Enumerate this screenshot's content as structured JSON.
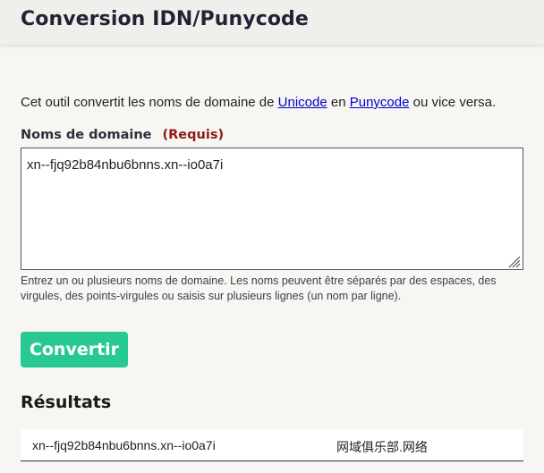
{
  "header": {
    "title": "Conversion IDN/Punycode"
  },
  "intro": {
    "prefix": "Cet outil convertit les noms de domaine de ",
    "link_unicode": "Unicode",
    "middle": " en ",
    "link_punycode": "Punycode",
    "suffix": " ou vice versa."
  },
  "form": {
    "label": "Noms de domaine",
    "required": "(Requis)",
    "value": "xn--fjq92b84nbu6bnns.xn--io0a7i",
    "help": "Entrez un ou plusieurs noms de domaine. Les noms peuvent être séparés par des espaces, des virgules, des points-virgules ou saisis sur plusieurs lignes (un nom par ligne).",
    "button_label": "Convertir"
  },
  "results": {
    "title": "Résultats",
    "rows": [
      {
        "punycode": "xn--fjq92b84nbu6bnns.xn--io0a7i",
        "unicode": "网域俱乐部.网络"
      }
    ]
  },
  "colors": {
    "button": "#28c894",
    "required": "#8b1a1a",
    "link": "#0000cc"
  }
}
